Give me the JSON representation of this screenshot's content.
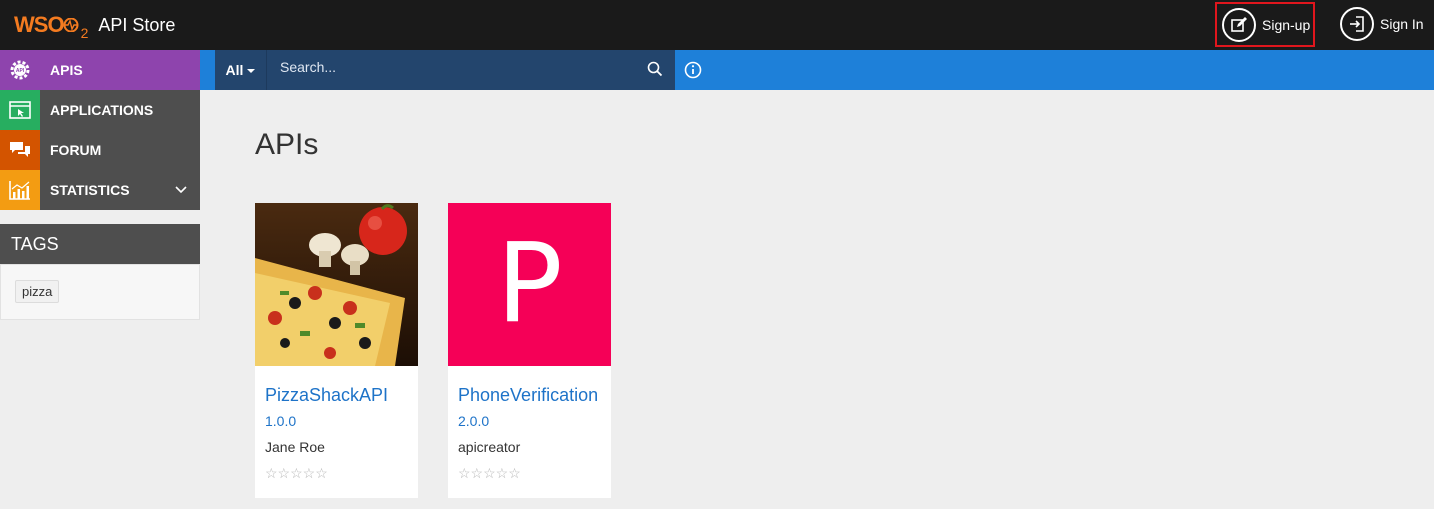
{
  "brand": {
    "logo_text": "WSO",
    "logo_sub": "2",
    "title": "API Store"
  },
  "top_actions": {
    "signup_label": "Sign-up",
    "signin_label": "Sign In"
  },
  "sidebar": {
    "items": [
      {
        "label": "APIS",
        "icon": "api-gear-icon",
        "color": "#8e44ad"
      },
      {
        "label": "APPLICATIONS",
        "icon": "application-window-icon",
        "color": "#27ae60"
      },
      {
        "label": "FORUM",
        "icon": "forum-chat-icon",
        "color": "#d35400"
      },
      {
        "label": "STATISTICS",
        "icon": "statistics-chart-icon",
        "color": "#f39c12"
      }
    ],
    "tags_title": "TAGS",
    "tags": [
      "pizza"
    ]
  },
  "search": {
    "filter_label": "All",
    "placeholder": "Search..."
  },
  "main": {
    "title": "APIs",
    "cards": [
      {
        "name": "PizzaShackAPI",
        "version": "1.0.0",
        "owner": "Jane Roe",
        "thumb": "pizza-photo",
        "stars": "☆☆☆☆☆",
        "rating": 0
      },
      {
        "name": "PhoneVerification",
        "version": "2.0.0",
        "owner": "apicreator",
        "thumb_letter": "P",
        "thumb_color": "#f50057",
        "stars": "☆☆☆☆☆",
        "rating": 0
      }
    ]
  },
  "colors": {
    "topbar": "#1a1a1a",
    "searchbar": "#1e80d9",
    "search_box": "#23456d",
    "link": "#1e73c8",
    "highlight_border": "#e0161d"
  }
}
